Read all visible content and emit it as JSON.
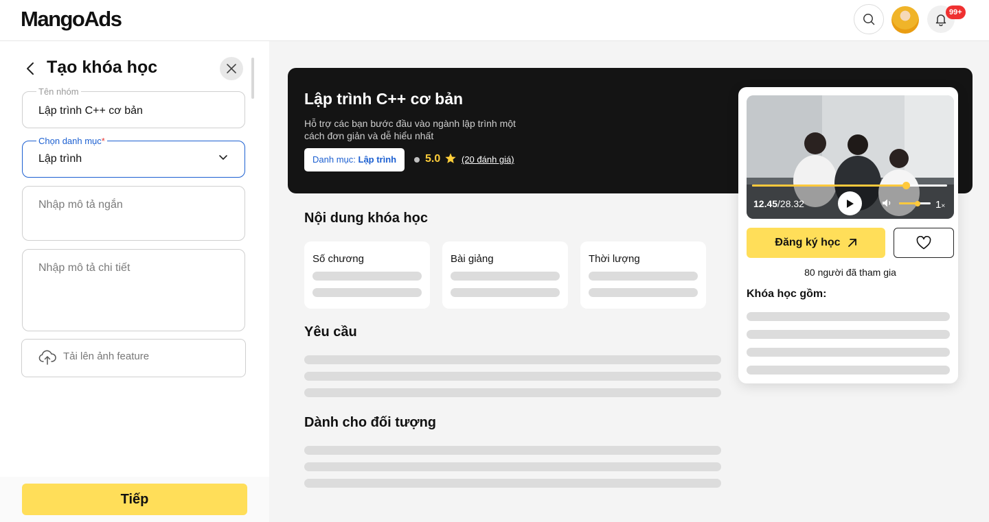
{
  "header": {
    "logo": "MangoAds",
    "notification_count": "99+"
  },
  "form": {
    "title": "Tạo khóa học",
    "group_name": {
      "label": "Tên nhóm",
      "value": "Lập trình C++ cơ bản"
    },
    "category": {
      "label": "Chọn danh mục",
      "required_mark": "*",
      "value": "Lập trình"
    },
    "short_desc": {
      "placeholder": "Nhập mô tả ngắn"
    },
    "detail_desc": {
      "placeholder": "Nhập mô tả chi tiết"
    },
    "upload": {
      "label": "Tải lên ảnh feature"
    },
    "next_label": "Tiếp"
  },
  "preview": {
    "title": "Lập trình C++ cơ bản",
    "description": "Hỗ trợ các bạn bước đầu vào ngành lập trình một cách đơn giản và dễ hiểu nhất",
    "category_prefix": "Danh mục:",
    "category_value": "Lập trình",
    "rating": "5.0",
    "reviews": "(20 đánh giá)",
    "content_title": "Nội dung khóa học",
    "stats": [
      {
        "label": "Số chương"
      },
      {
        "label": "Bài giảng"
      },
      {
        "label": "Thời lượng"
      }
    ],
    "requirements_title": "Yêu cầu",
    "audience_title": "Dành cho đối tượng"
  },
  "sidebar": {
    "video": {
      "current_time": "12.45",
      "total_time": "/28.32",
      "progress": 0.79,
      "volume": 0.58,
      "speed": "1",
      "speed_suffix": "×"
    },
    "enroll_label": "Đăng ký học",
    "joined": "80 người đã tham gia",
    "includes_title": "Khóa học gồm:"
  },
  "colors": {
    "accent": "#ffde59",
    "link": "#1b5fd1",
    "star": "#ffce3a",
    "badge": "#ef3030"
  }
}
